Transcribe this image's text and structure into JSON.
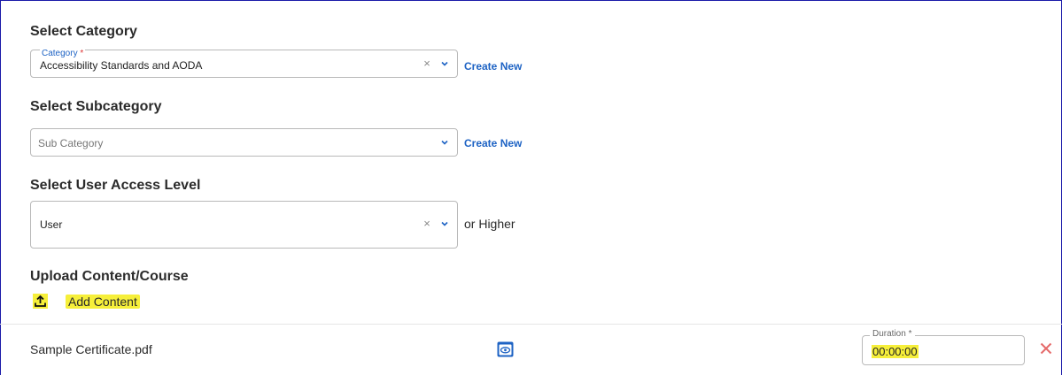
{
  "category_section": {
    "heading": "Select Category",
    "field_label": "Category",
    "required_mark": "*",
    "value": "Accessibility Standards and AODA",
    "clear_symbol": "×",
    "create_new": "Create New"
  },
  "subcategory_section": {
    "heading": "Select Subcategory",
    "placeholder": "Sub Category",
    "create_new": "Create New"
  },
  "access_section": {
    "heading": "Select User Access Level",
    "value": "User",
    "clear_symbol": "×",
    "suffix": "or Higher"
  },
  "upload_section": {
    "heading": "Upload Content/Course",
    "add_content": "Add Content",
    "upload_icon": "upload-icon"
  },
  "content_item": {
    "file_name": "Sample Certificate.pdf",
    "preview_icon": "eye-icon",
    "duration_label": "Duration",
    "required_mark": "*",
    "duration_value": "00:00:00",
    "remove_icon": "close-icon"
  },
  "colors": {
    "accent": "#1e63c4",
    "highlight": "#f6ef3a",
    "danger": "#e56a6a"
  }
}
